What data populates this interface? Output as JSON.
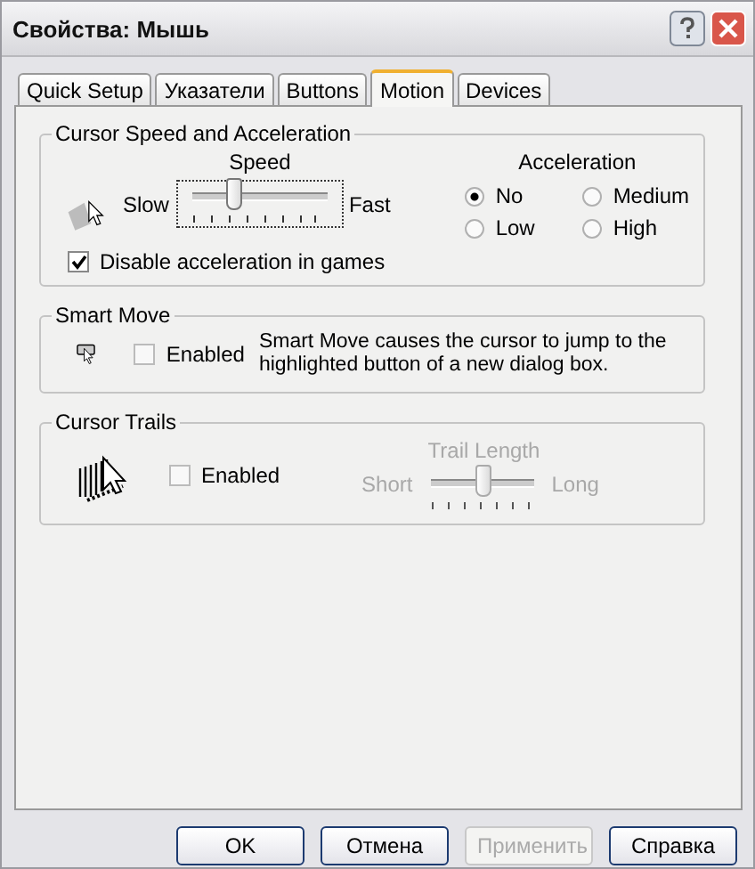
{
  "window": {
    "title": "Свойства: Мышь"
  },
  "tabs": [
    {
      "label": "Quick Setup",
      "selected": false
    },
    {
      "label": "Указатели",
      "selected": false
    },
    {
      "label": "Buttons",
      "selected": false
    },
    {
      "label": "Motion",
      "selected": true
    },
    {
      "label": "Devices",
      "selected": false
    }
  ],
  "speed_group": {
    "title": "Cursor Speed and Acceleration",
    "speed_label": "Speed",
    "slow": "Slow",
    "fast": "Fast",
    "level": 0.3,
    "acceleration_label": "Acceleration",
    "options": [
      {
        "label": "No",
        "selected": true
      },
      {
        "label": "Medium",
        "selected": false
      },
      {
        "label": "Low",
        "selected": false
      },
      {
        "label": "High",
        "selected": false
      }
    ],
    "games": {
      "label": "Disable acceleration in games",
      "checked": true
    }
  },
  "smart_move": {
    "title": "Smart Move",
    "enabled": {
      "label": "Enabled",
      "checked": false
    },
    "description": "Smart Move causes the cursor to jump to the highlighted button of a new dialog box."
  },
  "trails": {
    "title": "Cursor Trails",
    "enabled": {
      "label": "Enabled",
      "checked": false
    },
    "length_label": "Trail Length",
    "short": "Short",
    "long": "Long",
    "level": 0.5,
    "disabled": true
  },
  "buttons": [
    {
      "label": "OK",
      "disabled": false
    },
    {
      "label": "Отмена",
      "disabled": false
    },
    {
      "label": "Применить",
      "disabled": true
    },
    {
      "label": "Справка",
      "disabled": false
    }
  ]
}
